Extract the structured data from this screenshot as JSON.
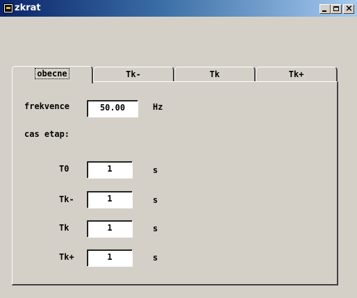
{
  "window": {
    "title": "zkrat"
  },
  "tabs": [
    {
      "label": "obecne"
    },
    {
      "label": "Tk-"
    },
    {
      "label": "Tk"
    },
    {
      "label": "Tk+"
    }
  ],
  "form": {
    "frequency": {
      "label": "frekvence",
      "value": "50.00",
      "unit": "Hz"
    },
    "stages_label": "cas etap:",
    "stages": [
      {
        "label": "T0",
        "value": "1",
        "unit": "s"
      },
      {
        "label": "Tk-",
        "value": "1",
        "unit": "s"
      },
      {
        "label": "Tk",
        "value": "1",
        "unit": "s"
      },
      {
        "label": "Tk+",
        "value": "1",
        "unit": "s"
      }
    ]
  }
}
